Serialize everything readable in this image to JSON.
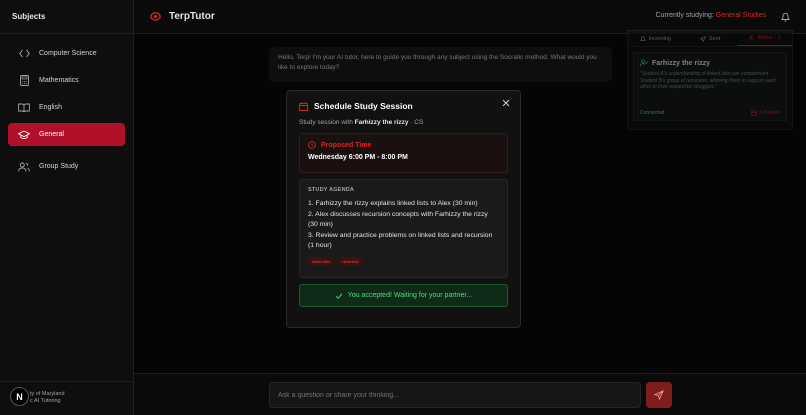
{
  "sidebar": {
    "header": "Subjects",
    "items": [
      {
        "label": "Computer Science",
        "icon": "code-icon",
        "active": false
      },
      {
        "label": "Mathematics",
        "icon": "calculator-icon",
        "active": false
      },
      {
        "label": "English",
        "icon": "book-icon",
        "active": false
      },
      {
        "label": "General",
        "icon": "graduation-cap-icon",
        "active": true
      },
      {
        "label": "Group Study",
        "icon": "users-icon",
        "active": false
      }
    ],
    "footer_line1": "ty of Maryland",
    "footer_line2": "c AI Tutoring",
    "badge": "N"
  },
  "header": {
    "title": "TerpTutor",
    "studying_label": "Currently studying: ",
    "studying_subject": "General Studies"
  },
  "right_panel": {
    "tabs": [
      "Incoming",
      "Sent",
      "Active · 1"
    ],
    "card": {
      "name": "Farhizzy the rizzy",
      "quote": "\"Student A's understanding of linked lists can complement Student B's grasp of recursion, allowing them to support each other in their respective struggles.\"",
      "status": "Connected",
      "schedule_label": "Schedule"
    }
  },
  "chat": {
    "message": "Hello, Terp! I'm your AI tutor, here to guide you through any subject using the Socratic method. What would you like to explore today?"
  },
  "modal": {
    "title": "Schedule Study Session",
    "sub_prefix": "Study session with ",
    "partner": "Farhizzy the rizzy",
    "sub_suffix": " · CS",
    "proposed_label": "Proposed Time",
    "proposed_time": "Wednesday 6:00 PM - 8:00 PM",
    "agenda_label": "STUDY AGENDA",
    "agenda": [
      "1. Farhizzy the rizzy explains linked lists to Alex (30 min)",
      "2. Alex discusses recursion concepts with Farhizzy the rizzy (30 min)",
      "3. Review and practice problems on linked lists and recursion (1 hour)"
    ],
    "tags": [
      "linked lists",
      "recursion"
    ],
    "accepted": "You accepted! Waiting for your partner..."
  },
  "input": {
    "placeholder": "Ask a question or share your thinking..."
  },
  "colors": {
    "accent": "#b0102a",
    "success": "#4ade80",
    "background": "#0a0a0a"
  }
}
